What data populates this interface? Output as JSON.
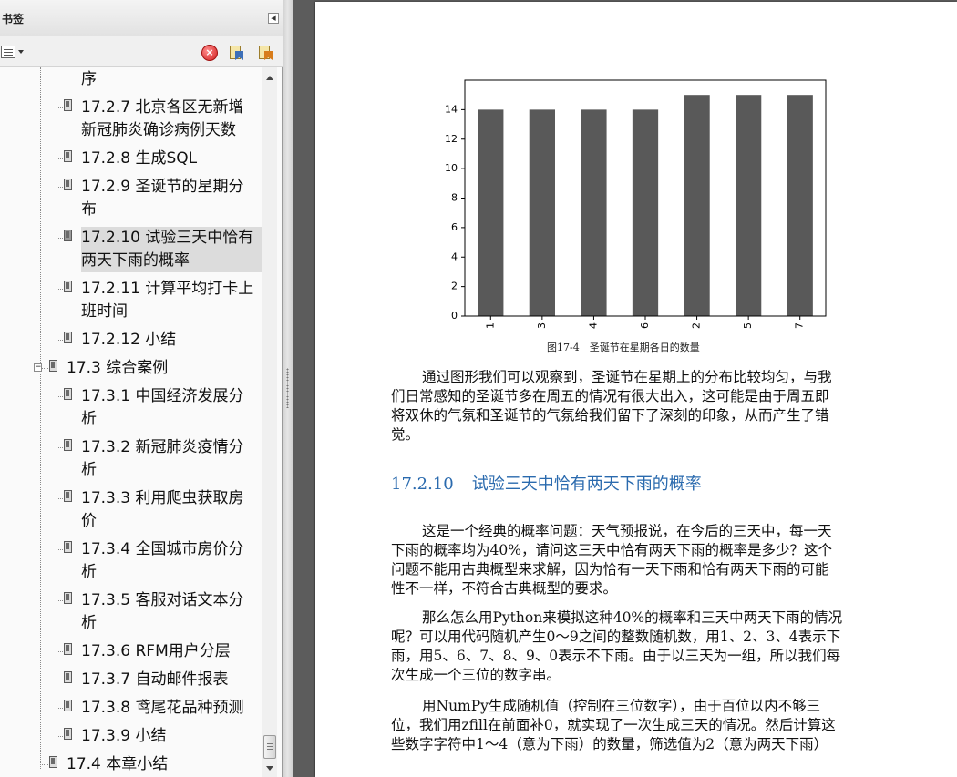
{
  "panel": {
    "title": "书签",
    "toolbar": {
      "options_icon": "options-icon",
      "delete_icon": "delete-icon",
      "delete_glyph": "×",
      "new_bookmark_icon": "new-bookmark-icon",
      "expand_icon": "expand-bookmark-icon"
    },
    "tree": [
      {
        "lines": [
          "序"
        ],
        "level": 2,
        "icon": false,
        "selected": false
      },
      {
        "lines": [
          "17.2.7 北京各区无新增",
          "新冠肺炎确诊病例天数"
        ],
        "level": 2,
        "icon": true,
        "selected": false
      },
      {
        "lines": [
          "17.2.8 生成SQL"
        ],
        "level": 2,
        "icon": true,
        "selected": false
      },
      {
        "lines": [
          "17.2.9 圣诞节的星期分",
          "布"
        ],
        "level": 2,
        "icon": true,
        "selected": false
      },
      {
        "lines": [
          "17.2.10 试验三天中恰有",
          "两天下雨的概率"
        ],
        "level": 2,
        "icon": true,
        "selected": true
      },
      {
        "lines": [
          "17.2.11 计算平均打卡上",
          "班时间"
        ],
        "level": 2,
        "icon": true,
        "selected": false
      },
      {
        "lines": [
          "17.2.12 小结"
        ],
        "level": 2,
        "icon": true,
        "selected": false
      },
      {
        "lines": [
          "17.3 综合案例"
        ],
        "level": 1,
        "icon": true,
        "selected": false,
        "toggle": "⊟"
      },
      {
        "lines": [
          "17.3.1 中国经济发展分",
          "析"
        ],
        "level": 2,
        "icon": true,
        "selected": false
      },
      {
        "lines": [
          "17.3.2 新冠肺炎疫情分",
          "析"
        ],
        "level": 2,
        "icon": true,
        "selected": false
      },
      {
        "lines": [
          "17.3.3 利用爬虫获取房",
          "价"
        ],
        "level": 2,
        "icon": true,
        "selected": false
      },
      {
        "lines": [
          "17.3.4 全国城市房价分",
          "析"
        ],
        "level": 2,
        "icon": true,
        "selected": false
      },
      {
        "lines": [
          "17.3.5 客服对话文本分",
          "析"
        ],
        "level": 2,
        "icon": true,
        "selected": false
      },
      {
        "lines": [
          "17.3.6 RFM用户分层"
        ],
        "level": 2,
        "icon": true,
        "selected": false
      },
      {
        "lines": [
          "17.3.7 自动邮件报表"
        ],
        "level": 2,
        "icon": true,
        "selected": false
      },
      {
        "lines": [
          "17.3.8 鸢尾花品种预测"
        ],
        "level": 2,
        "icon": true,
        "selected": false
      },
      {
        "lines": [
          "17.3.9 小结"
        ],
        "level": 2,
        "icon": true,
        "selected": false
      },
      {
        "lines": [
          "17.4 本章小结"
        ],
        "level": 1,
        "icon": true,
        "selected": false
      }
    ]
  },
  "document": {
    "figure_caption": "图17-4　圣诞节在星期各日的数量",
    "paragraph1": [
      "通过图形我们可以观察到，圣诞节在星期上的分布比较均匀，与我",
      "们日常感知的圣诞节多在周五的情况有很大出入，这可能是由于周五即",
      "将双休的气氛和圣诞节的气氛给我们留下了深刻的印象，从而产生了错",
      "觉。"
    ],
    "section_number": "17.2.10",
    "section_title": "试验三天中恰有两天下雨的概率",
    "paragraph2": [
      "这是一个经典的概率问题：天气预报说，在今后的三天中，每一天",
      "下雨的概率均为40%，请问这三天中恰有两天下雨的概率是多少？这个",
      "问题不能用古典概型来求解，因为恰有一天下雨和恰有两天下雨的可能",
      "性不一样，不符合古典概型的要求。"
    ],
    "paragraph3": [
      "那么怎么用Python来模拟这种40%的概率和三天中两天下雨的情况",
      "呢？可以用代码随机产生0～9之间的整数随机数，用1、2、3、4表示下",
      "雨，用5、6、7、8、9、0表示不下雨。由于以三天为一组，所以我们每",
      "次生成一个三位的数字串。"
    ],
    "paragraph4": [
      "用NumPy生成随机值（控制在三位数字），由于百位以内不够三",
      "位，我们用zfill在前面补0，就实现了一次生成三天的情况。然后计算这",
      "些数字字符中1～4（意为下雨）的数量，筛选值为2（意为两天下雨）"
    ]
  },
  "chart_data": {
    "type": "bar",
    "categories": [
      "1",
      "3",
      "4",
      "6",
      "2",
      "5",
      "7"
    ],
    "values": [
      14,
      14,
      14,
      14,
      15,
      15,
      15
    ],
    "ylim": [
      0,
      16
    ],
    "yticks": [
      0,
      2,
      4,
      6,
      8,
      10,
      12,
      14
    ],
    "bar_color": "#595959",
    "grid": false,
    "title": "",
    "xlabel": "",
    "ylabel": ""
  },
  "colors": {
    "heading": "#2a6aae",
    "background": "#5c5c5c"
  }
}
